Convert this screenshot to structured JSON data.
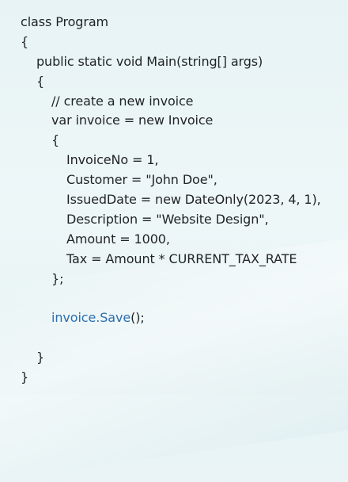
{
  "code": {
    "lines": [
      {
        "text": "class Program"
      },
      {
        "text": "{"
      },
      {
        "text": "public static void Main(string[] args)"
      },
      {
        "text": "{"
      },
      {
        "text": "// create a new invoice"
      },
      {
        "text": "var invoice = new Invoice"
      },
      {
        "text": "{"
      },
      {
        "text": "InvoiceNo = 1,"
      },
      {
        "text": "Customer = \"John Doe\","
      },
      {
        "text": "IssuedDate = new DateOnly(2023, 4, 1),"
      },
      {
        "text": "Description = \"Website Design\","
      },
      {
        "text": "Amount = 1000,"
      },
      {
        "text": "Tax = Amount * CURRENT_TAX_RATE"
      },
      {
        "text": "};"
      },
      {
        "text": ""
      },
      {
        "text_blue": "invoice.Save",
        "text_rest": "();"
      },
      {
        "text": ""
      },
      {
        "text": "}"
      },
      {
        "text": "}"
      }
    ]
  },
  "colors": {
    "code_text": "#1f2326",
    "code_highlight": "#2a6fb1",
    "background": "#eaf5f6"
  }
}
